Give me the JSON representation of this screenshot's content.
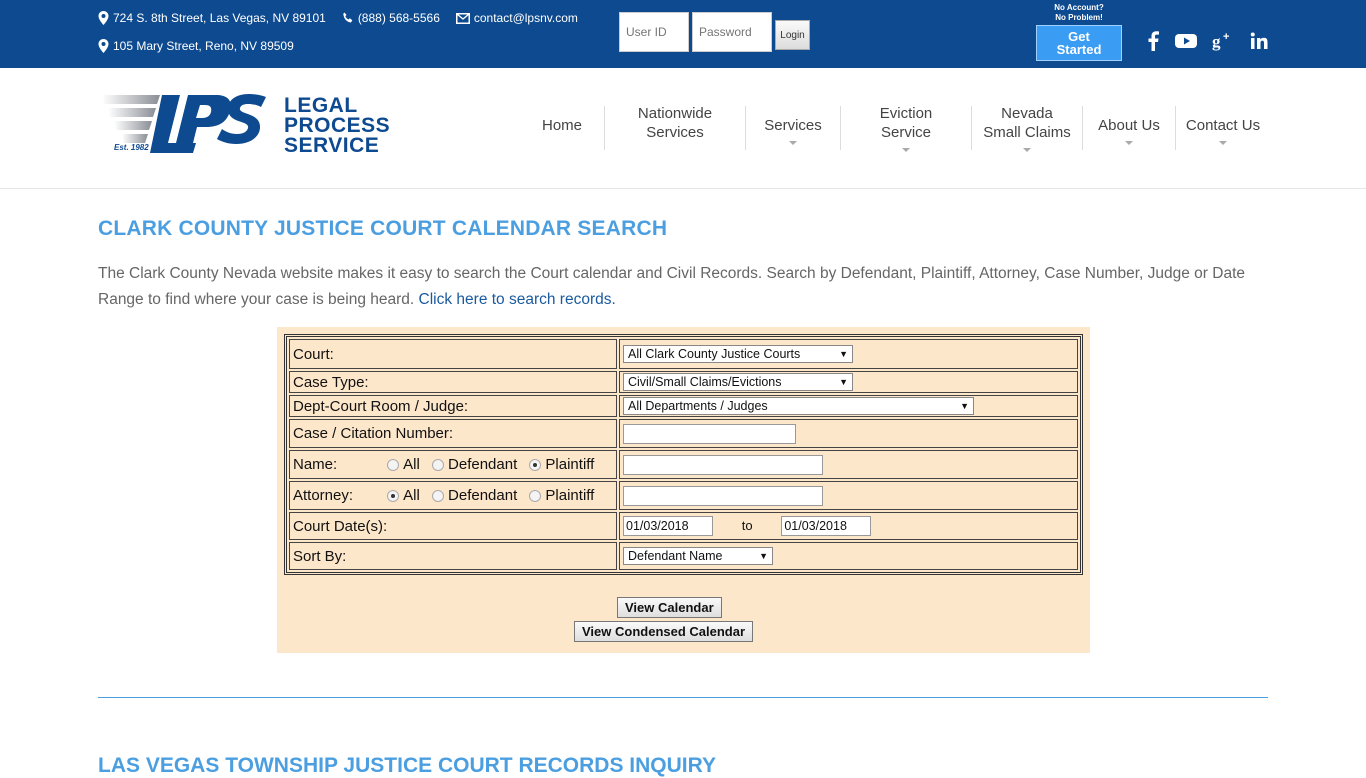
{
  "topbar": {
    "address1": "724 S. 8th Street, Las Vegas, NV 89101",
    "phone": "(888) 568-5566",
    "email": "contact@lpsnv.com",
    "address2": "105 Mary Street, Reno, NV 89509",
    "user_id_placeholder": "User ID",
    "password_placeholder": "Password",
    "login_label": "Login",
    "no_account_line1": "No Account?",
    "no_account_line2": "No Problem!",
    "get_started_line1": "Get",
    "get_started_line2": "Started",
    "social": [
      "facebook-icon",
      "youtube-icon",
      "google-plus-icon",
      "linkedin-icon"
    ],
    "colors": {
      "bar": "#0e4a8f",
      "button": "#3a9cf2"
    }
  },
  "logo": {
    "line1": "LEGAL",
    "line2": "PROCESS",
    "line3": "SERVICE",
    "est": "Est. 1982"
  },
  "nav": {
    "home": "Home",
    "nationwide_1": "Nationwide",
    "nationwide_2": "Services",
    "services": "Services",
    "eviction_1": "Eviction",
    "eviction_2": "Service",
    "nevada_1": "Nevada",
    "nevada_2": "Small Claims",
    "about": "About Us",
    "contact": "Contact Us"
  },
  "main": {
    "title": "CLARK COUNTY JUSTICE COURT CALENDAR SEARCH",
    "intro_text": "The Clark County Nevada website makes it easy to search the Court calendar and Civil Records. Search by Defendant, Plaintiff, Attorney, Case Number, Judge or Date Range to find where your case is being heard. ",
    "intro_link": "Click here to search records.",
    "next_title": "LAS VEGAS TOWNSHIP JUSTICE COURT RECORDS INQUIRY"
  },
  "form": {
    "court_label": "Court:",
    "court_value": "All Clark County Justice Courts",
    "case_type_label": "Case Type:",
    "case_type_value": "Civil/Small Claims/Evictions",
    "dept_label": "Dept-Court Room / Judge:",
    "dept_value": "All Departments / Judges",
    "case_number_label": "Case / Citation Number:",
    "case_number_value": "",
    "name_label": "Name:",
    "attorney_label": "Attorney:",
    "opt_all": "All",
    "opt_defendant": "Defendant",
    "opt_plaintiff": "Plaintiff",
    "name_selected": "Plaintiff",
    "attorney_selected": "All",
    "name_value": "",
    "attorney_value": "",
    "court_dates_label": "Court Date(s):",
    "date_from": "01/03/2018",
    "date_to_label": "to",
    "date_to": "01/03/2018",
    "sort_label": "Sort By:",
    "sort_value": "Defendant Name",
    "view_calendar": "View Calendar",
    "view_condensed": "View Condensed Calendar",
    "colors": {
      "panel": "#fde7cb",
      "title": "#4b9fe1"
    }
  }
}
